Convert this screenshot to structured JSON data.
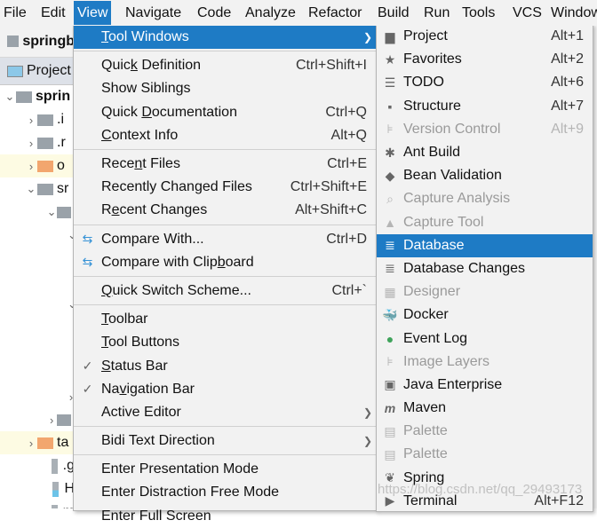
{
  "menubar": [
    {
      "label": "File",
      "m": 0
    },
    {
      "label": "Edit",
      "m": 0
    },
    {
      "label": "View",
      "m": 0,
      "active": true
    },
    {
      "label": "Navigate",
      "m": 0
    },
    {
      "label": "Code",
      "m": 0
    },
    {
      "label": "Analyze",
      "m": 5
    },
    {
      "label": "Refactor",
      "m": 0
    },
    {
      "label": "Build",
      "m": 0
    },
    {
      "label": "Run",
      "m": 1
    },
    {
      "label": "Tools",
      "m": 0
    },
    {
      "label": "VCS",
      "m": 2
    },
    {
      "label": "Window",
      "m": 0
    }
  ],
  "left": {
    "nav_title": "springb",
    "panel_title": "Project",
    "tree": [
      {
        "chev": "⌄",
        "icon": "folder",
        "text": "sprin",
        "bold": true,
        "indent": 0
      },
      {
        "chev": "›",
        "icon": "folder",
        "text": ".i",
        "indent": 1
      },
      {
        "chev": "›",
        "icon": "folder",
        "text": ".r",
        "indent": 1
      },
      {
        "chev": "›",
        "icon": "folder-orange",
        "text": "o",
        "indent": 1,
        "hl": true
      },
      {
        "chev": "⌄",
        "icon": "folder",
        "text": "sr",
        "indent": 1
      },
      {
        "chev": "⌄",
        "icon": "folder",
        "text": "",
        "indent": 2
      },
      {
        "chev": "⌄",
        "icon": "",
        "text": "",
        "indent": 3
      },
      {
        "chev": "",
        "icon": "",
        "text": "",
        "indent": 3
      },
      {
        "chev": "",
        "icon": "",
        "text": "",
        "indent": 3
      },
      {
        "chev": "⌄",
        "icon": "",
        "text": "",
        "indent": 3
      },
      {
        "chev": "",
        "icon": "",
        "text": "",
        "indent": 3
      },
      {
        "chev": "",
        "icon": "",
        "text": "",
        "indent": 3
      },
      {
        "chev": "",
        "icon": "",
        "text": "",
        "indent": 3
      },
      {
        "chev": "›",
        "icon": "",
        "text": "",
        "indent": 3
      },
      {
        "chev": "›",
        "icon": "folder",
        "text": "",
        "indent": 2
      },
      {
        "chev": "›",
        "icon": "folder-orange",
        "text": "ta",
        "indent": 1,
        "hl": true
      },
      {
        "chev": "",
        "icon": "file",
        "text": ".g",
        "indent": 2
      },
      {
        "chev": "",
        "icon": "md-file",
        "text": "H",
        "indent": 2
      },
      {
        "chev": "",
        "icon": "file",
        "text": "m",
        "indent": 2
      }
    ]
  },
  "view_menu": [
    {
      "label": "Tool Windows",
      "m": 0,
      "submenu": true,
      "selected": true
    },
    {
      "sep": true
    },
    {
      "label": "Quick Definition",
      "m": 4,
      "shortcut": "Ctrl+Shift+I"
    },
    {
      "label": "Show Siblings"
    },
    {
      "label": "Quick Documentation",
      "m": 6,
      "shortcut": "Ctrl+Q"
    },
    {
      "label": "Context Info",
      "m": 0,
      "shortcut": "Alt+Q"
    },
    {
      "sep": true
    },
    {
      "label": "Recent Files",
      "m": 4,
      "shortcut": "Ctrl+E"
    },
    {
      "label": "Recently Changed Files",
      "shortcut": "Ctrl+Shift+E"
    },
    {
      "label": "Recent Changes",
      "m": 1,
      "shortcut": "Alt+Shift+C"
    },
    {
      "sep": true
    },
    {
      "label": "Compare With...",
      "icon": "compare-icon",
      "glyph": "⇆",
      "shortcut": "Ctrl+D"
    },
    {
      "label": "Compare with Clipboard",
      "m": 17,
      "icon": "compare-clipboard-icon",
      "glyph": "⇆"
    },
    {
      "sep": true
    },
    {
      "label": "Quick Switch Scheme...",
      "m": 0,
      "shortcut": "Ctrl+`"
    },
    {
      "sep": true
    },
    {
      "label": "Toolbar",
      "m": 0
    },
    {
      "label": "Tool Buttons",
      "m": 0
    },
    {
      "label": "Status Bar",
      "m": 0,
      "checked": true
    },
    {
      "label": "Navigation Bar",
      "m": 2,
      "checked": true
    },
    {
      "label": "Active Editor",
      "submenu": true
    },
    {
      "sep": true
    },
    {
      "label": "Bidi Text Direction",
      "submenu": true
    },
    {
      "sep": true
    },
    {
      "label": "Enter Presentation Mode"
    },
    {
      "label": "Enter Distraction Free Mode"
    },
    {
      "label": "Enter Full Screen"
    }
  ],
  "tool_windows_menu": [
    {
      "label": "Project",
      "icon": "folder-icon",
      "glyph": "▆",
      "shortcut": "Alt+1"
    },
    {
      "label": "Favorites",
      "icon": "star-icon",
      "glyph": "★",
      "shortcut": "Alt+2"
    },
    {
      "label": "TODO",
      "icon": "list-icon",
      "glyph": "☰",
      "shortcut": "Alt+6"
    },
    {
      "label": "Structure",
      "icon": "structure-icon",
      "glyph": "▪",
      "shortcut": "Alt+7"
    },
    {
      "label": "Version Control",
      "icon": "version-control-icon",
      "glyph": "⊧",
      "shortcut": "Alt+9",
      "disabled": true
    },
    {
      "label": "Ant Build",
      "icon": "ant-icon",
      "glyph": "✱"
    },
    {
      "label": "Bean Validation",
      "icon": "bean-validation-icon",
      "glyph": "◆"
    },
    {
      "label": "Capture Analysis",
      "icon": "magnifier-icon",
      "glyph": "⌕",
      "disabled": true
    },
    {
      "label": "Capture Tool",
      "icon": "triangle-icon",
      "glyph": "▲",
      "disabled": true
    },
    {
      "label": "Database",
      "icon": "database-icon",
      "glyph": "≣",
      "selected": true
    },
    {
      "label": "Database Changes",
      "icon": "database-changes-icon",
      "glyph": "≣"
    },
    {
      "label": "Designer",
      "icon": "designer-icon",
      "glyph": "▦",
      "disabled": true
    },
    {
      "label": "Docker",
      "icon": "docker-icon",
      "glyph": "🐳",
      "color": "#1d9ad6"
    },
    {
      "label": "Event Log",
      "icon": "event-log-icon",
      "glyph": "●",
      "color": "#3fa35b"
    },
    {
      "label": "Image Layers",
      "icon": "image-layers-icon",
      "glyph": "⊧",
      "disabled": true
    },
    {
      "label": "Java Enterprise",
      "icon": "java-enterprise-icon",
      "glyph": "▣"
    },
    {
      "label": "Maven",
      "icon": "maven-icon",
      "glyph": "m"
    },
    {
      "label": "Palette",
      "icon": "palette-icon",
      "glyph": "▤",
      "disabled": true
    },
    {
      "label": "Palette",
      "icon": "palette-icon",
      "glyph": "▤",
      "disabled": true
    },
    {
      "label": "Spring",
      "icon": "spring-leaf-icon",
      "glyph": "❦"
    },
    {
      "label": "Terminal",
      "icon": "terminal-icon",
      "glyph": "▶",
      "shortcut": "Alt+F12"
    }
  ],
  "watermark": "https://blog.csdn.net/qq_29493173",
  "colors": {
    "accent": "#1e7bc5",
    "menu_bg": "#f2f2f2",
    "disabled": "#9a9a9a"
  }
}
